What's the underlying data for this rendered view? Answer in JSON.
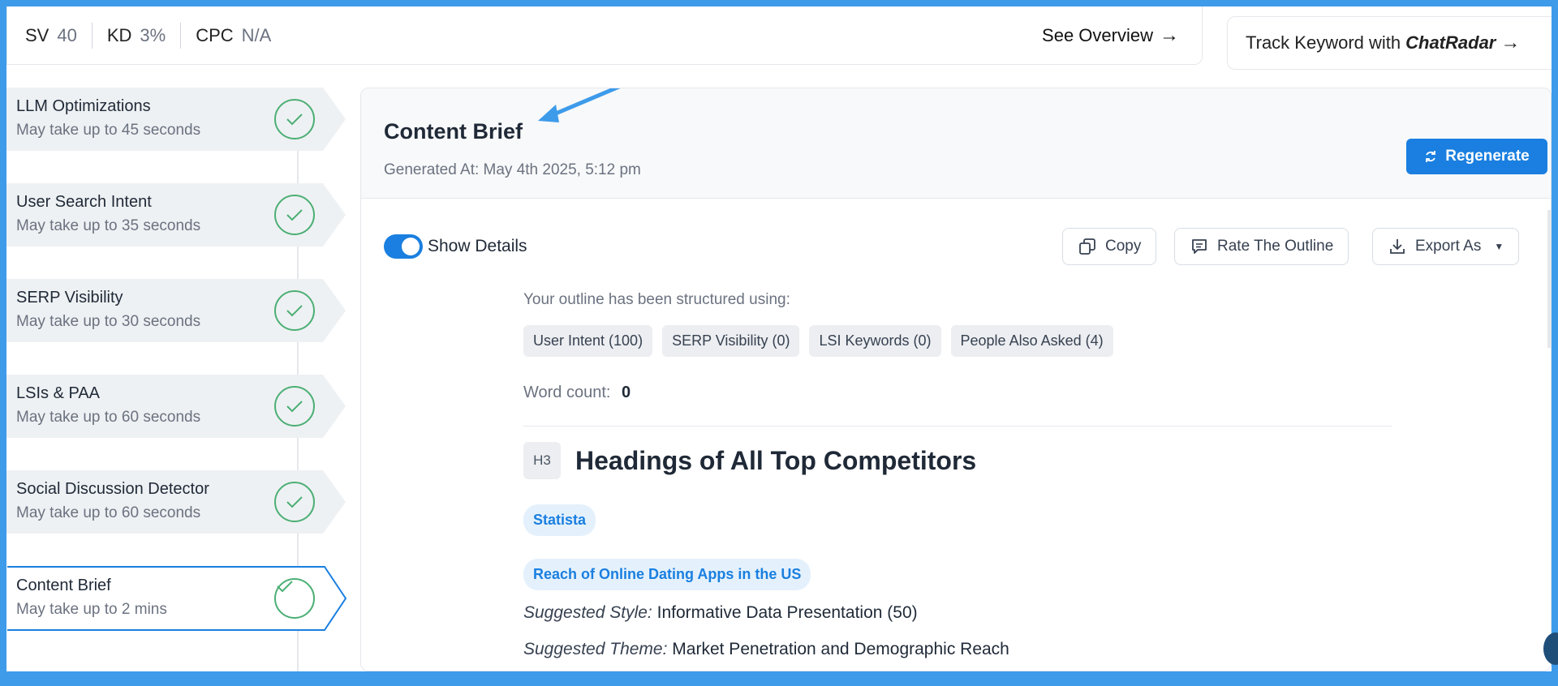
{
  "topbar": {
    "metrics": [
      {
        "label": "SV",
        "value": "40"
      },
      {
        "label": "KD",
        "value": "3%"
      },
      {
        "label": "CPC",
        "value": "N/A"
      }
    ],
    "overview_label": "See Overview",
    "track_label": "Track Keyword with",
    "track_brand": "ChatRadar"
  },
  "steps": [
    {
      "title": "LLM Optimizations",
      "sub": "May take up to 45 seconds"
    },
    {
      "title": "User Search Intent",
      "sub": "May take up to 35 seconds"
    },
    {
      "title": "SERP Visibility",
      "sub": "May take up to 30 seconds"
    },
    {
      "title": "LSIs & PAA",
      "sub": "May take up to 60 seconds"
    },
    {
      "title": "Social Discussion Detector",
      "sub": "May take up to 60 seconds"
    },
    {
      "title": "Content Brief",
      "sub": "May take up to 2 mins"
    }
  ],
  "panel": {
    "title": "Content Brief",
    "generated": "Generated At: May 4th 2025, 5:12 pm",
    "regenerate_label": "Regenerate",
    "show_details_label": "Show Details",
    "copy_label": "Copy",
    "rate_label": "Rate The Outline",
    "export_label": "Export As"
  },
  "outline": {
    "intro": "Your outline has been structured using:",
    "chips": [
      "User Intent (100)",
      "SERP Visibility (0)",
      "LSI Keywords (0)",
      "People Also Asked (4)"
    ],
    "word_count_label": "Word count:",
    "word_count": "0",
    "heading_level": "H3",
    "heading": "Headings of All Top Competitors",
    "source_tag": "Statista",
    "topic_tag": "Reach of Online Dating Apps in the US",
    "style_label": "Suggested Style:",
    "style_value": "Informative Data Presentation (50)",
    "theme_label": "Suggested Theme:",
    "theme_value": "Market Penetration and Demographic Reach"
  },
  "colors": {
    "accent": "#1a7fe0",
    "frame": "#3d9bea",
    "check": "#4caf75"
  }
}
